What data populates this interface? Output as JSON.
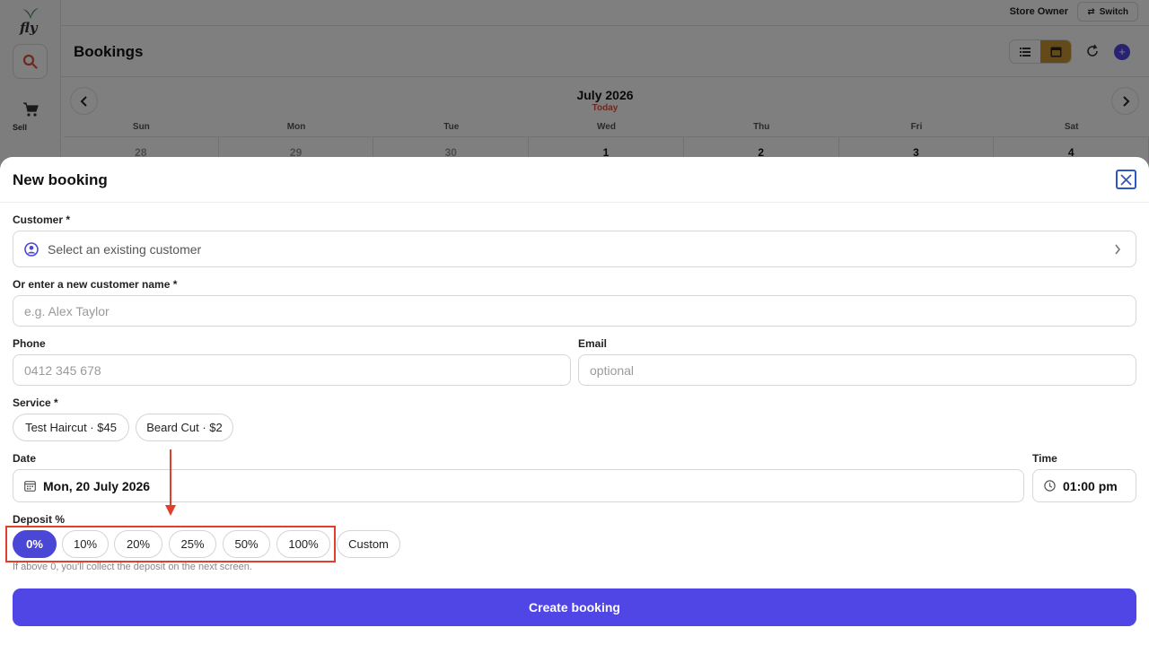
{
  "app": {
    "logo_text": "fly",
    "sidebar": {
      "sell_label": "Sell"
    },
    "topbar": {
      "store_owner": "Store Owner",
      "switch_label": "Switch"
    },
    "page_title": "Bookings"
  },
  "calendar": {
    "month_title": "July 2026",
    "today_label": "Today",
    "weekdays": [
      "Sun",
      "Mon",
      "Tue",
      "Wed",
      "Thu",
      "Fri",
      "Sat"
    ],
    "day_numbers": [
      "28",
      "29",
      "30",
      "1",
      "2",
      "3",
      "4"
    ]
  },
  "modal": {
    "title": "New booking",
    "customer_label": "Customer *",
    "customer_select_placeholder": "Select an existing customer",
    "new_customer_label": "Or enter a new customer name *",
    "new_customer_placeholder": "e.g. Alex Taylor",
    "phone_label": "Phone",
    "phone_placeholder": "0412 345 678",
    "email_label": "Email",
    "email_placeholder": "optional",
    "service_label": "Service *",
    "services": [
      "Test Haircut · $45",
      "Beard Cut · $2"
    ],
    "date_label": "Date",
    "date_value": "Mon, 20 July 2026",
    "time_label": "Time",
    "time_value": "01:00 pm",
    "deposit_label": "Deposit %",
    "deposit_options": [
      "0%",
      "10%",
      "20%",
      "25%",
      "50%",
      "100%",
      "Custom"
    ],
    "deposit_selected": "0%",
    "deposit_hint": "If above 0, you'll collect the deposit on the next screen.",
    "create_button": "Create booking"
  },
  "colors": {
    "primary": "#4f46e5",
    "accent_gold": "#c89433",
    "annotation_red": "#e0402b",
    "today_red": "#d9533a"
  }
}
